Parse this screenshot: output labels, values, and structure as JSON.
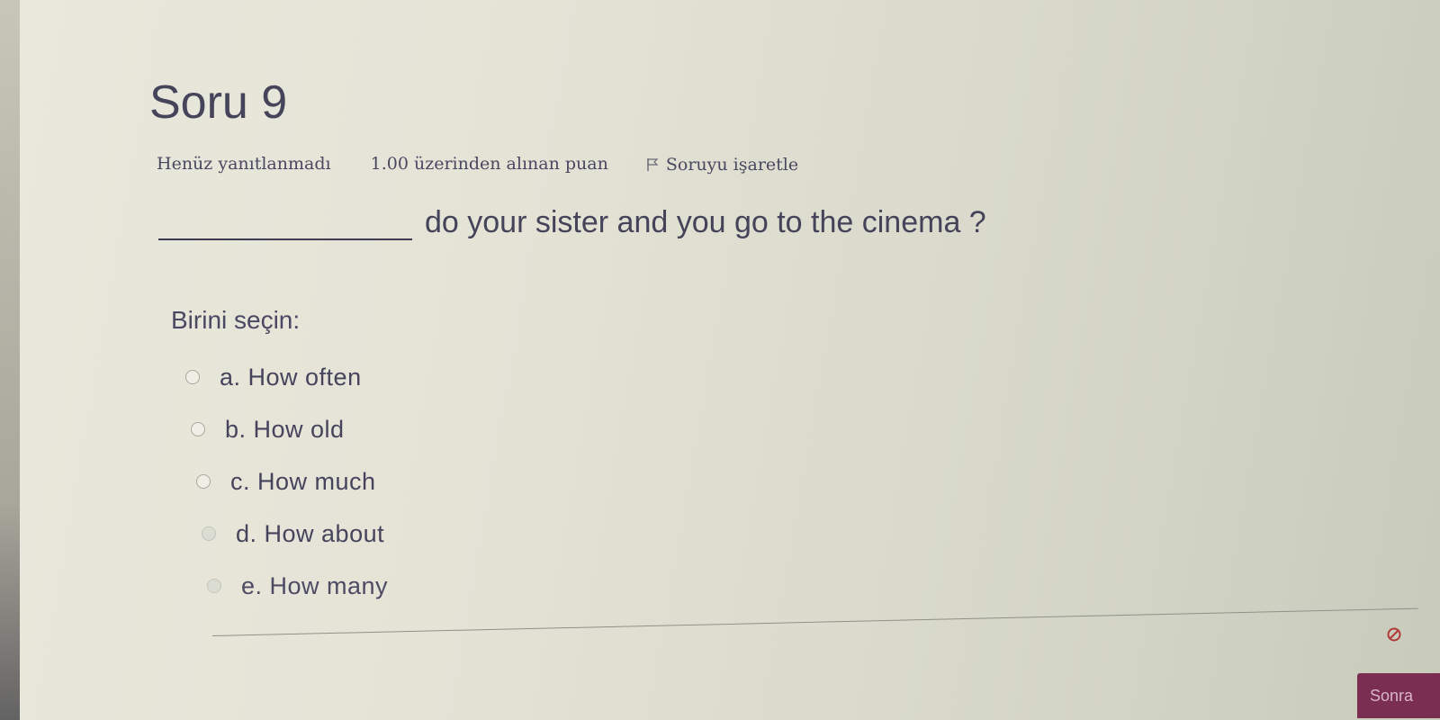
{
  "question": {
    "title": "Soru 9",
    "status": "Henüz yanıtlanmadı",
    "grade": "1.00 üzerinden alınan puan",
    "flag_label": "Soruyu işaretle",
    "text": "do your sister and you go to the cinema ?",
    "prompt": "Birini seçin:",
    "options": [
      {
        "label": "a. How often",
        "selected": false
      },
      {
        "label": "b. How old",
        "selected": false
      },
      {
        "label": "c. How much",
        "selected": false
      },
      {
        "label": "d. How about",
        "selected": false
      },
      {
        "label": "e. How many",
        "selected": false
      }
    ]
  },
  "navigation": {
    "next_label": "Sonra"
  },
  "colors": {
    "background": "#e5e4d8",
    "text": "#46445a",
    "button": "#7a2e52"
  },
  "icons": {
    "flag": "flag-icon",
    "corner": "settings-icon"
  }
}
